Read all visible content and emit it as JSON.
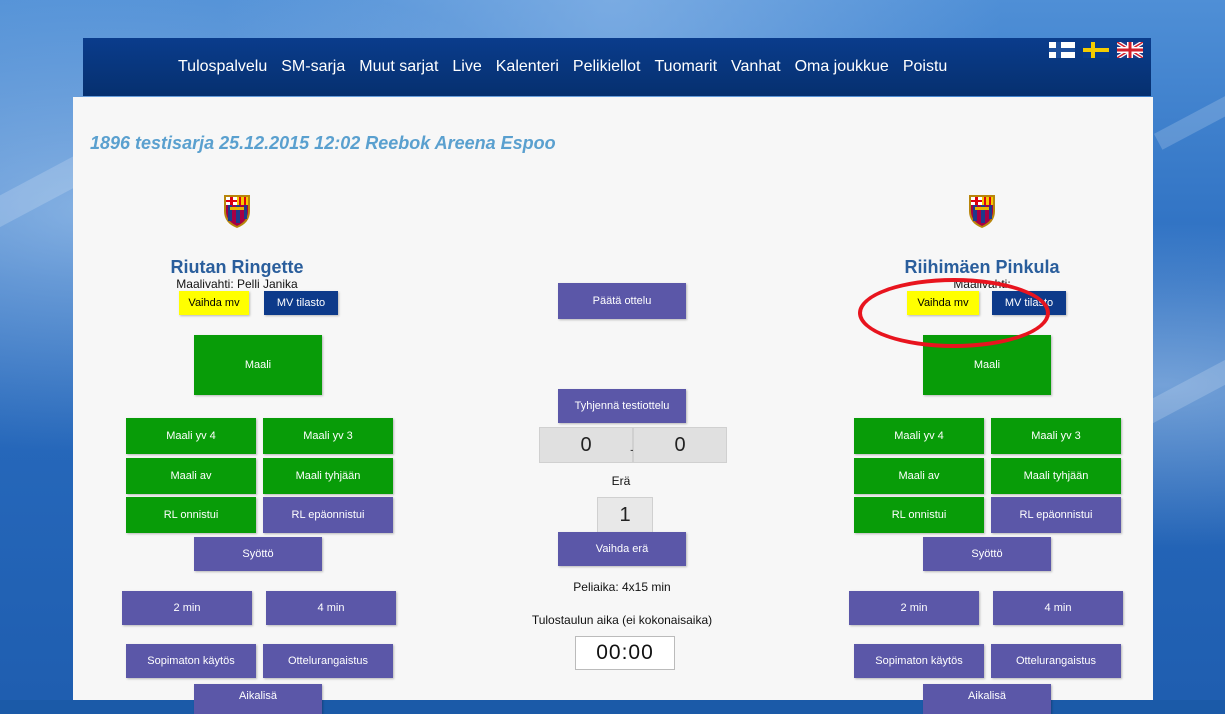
{
  "nav": {
    "items": [
      "Tulospalvelu",
      "SM-sarja",
      "Muut sarjat",
      "Live",
      "Kalenteri",
      "Pelikiellot",
      "Tuomarit",
      "Vanhat",
      "Oma joukkue",
      "Poistu"
    ],
    "languages": [
      "finnish-flag-icon",
      "swedish-flag-icon",
      "uk-flag-icon"
    ]
  },
  "match": {
    "title": "1896 testisarja 25.12.2015 12:02 Reebok Areena Espoo"
  },
  "home": {
    "name": "Riutan Ringette",
    "goalie": "Maalivahti: Pelli Janika",
    "change_goalie": "Vaihda mv",
    "goalie_stats": "MV tilasto",
    "goal": "Maali",
    "goal_pp4": "Maali yv 4",
    "goal_pp3": "Maali yv 3",
    "goal_sh": "Maali av",
    "goal_empty": "Maali tyhjään",
    "ps_success": "RL onnistui",
    "ps_fail": "RL epäonnistui",
    "assist": "Syöttö",
    "pen2": "2 min",
    "pen4": "4 min",
    "misconduct": "Sopimaton käytös",
    "match_penalty": "Ottelurangaistus",
    "timeout": "Aikalisä"
  },
  "away": {
    "name": "Riihimäen Pinkula",
    "goalie": "Maalivahti:",
    "change_goalie": "Vaihda mv",
    "goalie_stats": "MV tilasto",
    "goal": "Maali",
    "goal_pp4": "Maali yv 4",
    "goal_pp3": "Maali yv 3",
    "goal_sh": "Maali av",
    "goal_empty": "Maali tyhjään",
    "ps_success": "RL onnistui",
    "ps_fail": "RL epäonnistui",
    "assist": "Syöttö",
    "pen2": "2 min",
    "pen4": "4 min",
    "misconduct": "Sopimaton käytös",
    "match_penalty": "Ottelurangaistus",
    "timeout": "Aikalisä"
  },
  "center": {
    "end_match": "Päätä ottelu",
    "clear_test": "Tyhjennä testiottelu",
    "score_home": "0",
    "score_sep": "-",
    "score_away": "0",
    "period_label": "Erä",
    "period_value": "1",
    "change_period": "Vaihda erä",
    "game_time": "Peliaika: 4x15 min",
    "clock_label": "Tulostaulun aika (ei kokonaisaika)",
    "clock_value": "00:00"
  },
  "colors": {
    "navbar": "#06306f",
    "green": "#089c08",
    "purple": "#5b57a8",
    "navy": "#0d3a8a",
    "yellow": "#ffff00",
    "annotation": "#e8141e",
    "title": "#5aa0cf",
    "team_name": "#2a5e9c"
  }
}
